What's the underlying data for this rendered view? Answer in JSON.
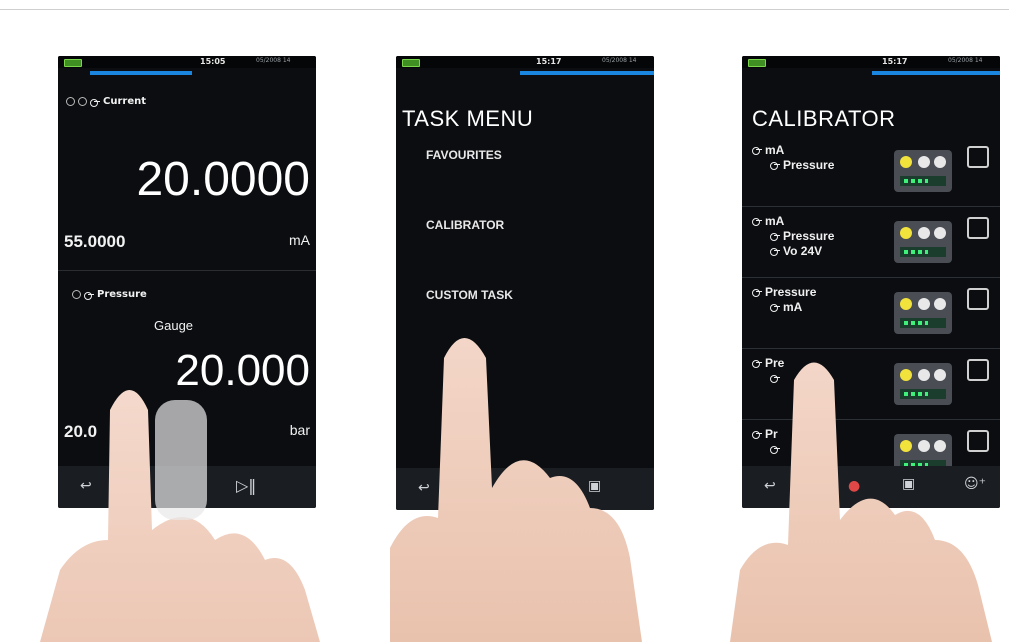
{
  "screens": {
    "measure": {
      "clock": "15:05",
      "date": "05/2008 14",
      "upper": {
        "label": "Current",
        "value": "20.0000",
        "secondary_value": "55.0000",
        "unit": "mA"
      },
      "lower": {
        "label": "Pressure",
        "sublabel": "Gauge",
        "value": "20.000",
        "secondary_value": "20.0",
        "unit": "bar"
      }
    },
    "task_menu": {
      "clock": "15:17",
      "date": "05/2008 14",
      "title": "TASK MENU",
      "items": [
        "FAVOURITES",
        "CALIBRATOR",
        "CUSTOM TASK"
      ]
    },
    "calibrator": {
      "clock": "15:17",
      "date": "05/2008 14",
      "title": "CALIBRATOR",
      "tasks": [
        {
          "lines": [
            "mA",
            "Pressure"
          ]
        },
        {
          "lines": [
            "mA",
            "Pressure",
            "Vo 24V"
          ]
        },
        {
          "lines": [
            "Pressure",
            "mA"
          ]
        },
        {
          "lines": [
            "Pre",
            ""
          ]
        },
        {
          "lines": [
            "Pr",
            ""
          ]
        }
      ]
    }
  },
  "colors": {
    "accent": "#1a86e0",
    "screen_bg": "#0b0d10",
    "navbar": "#1a1d21"
  }
}
